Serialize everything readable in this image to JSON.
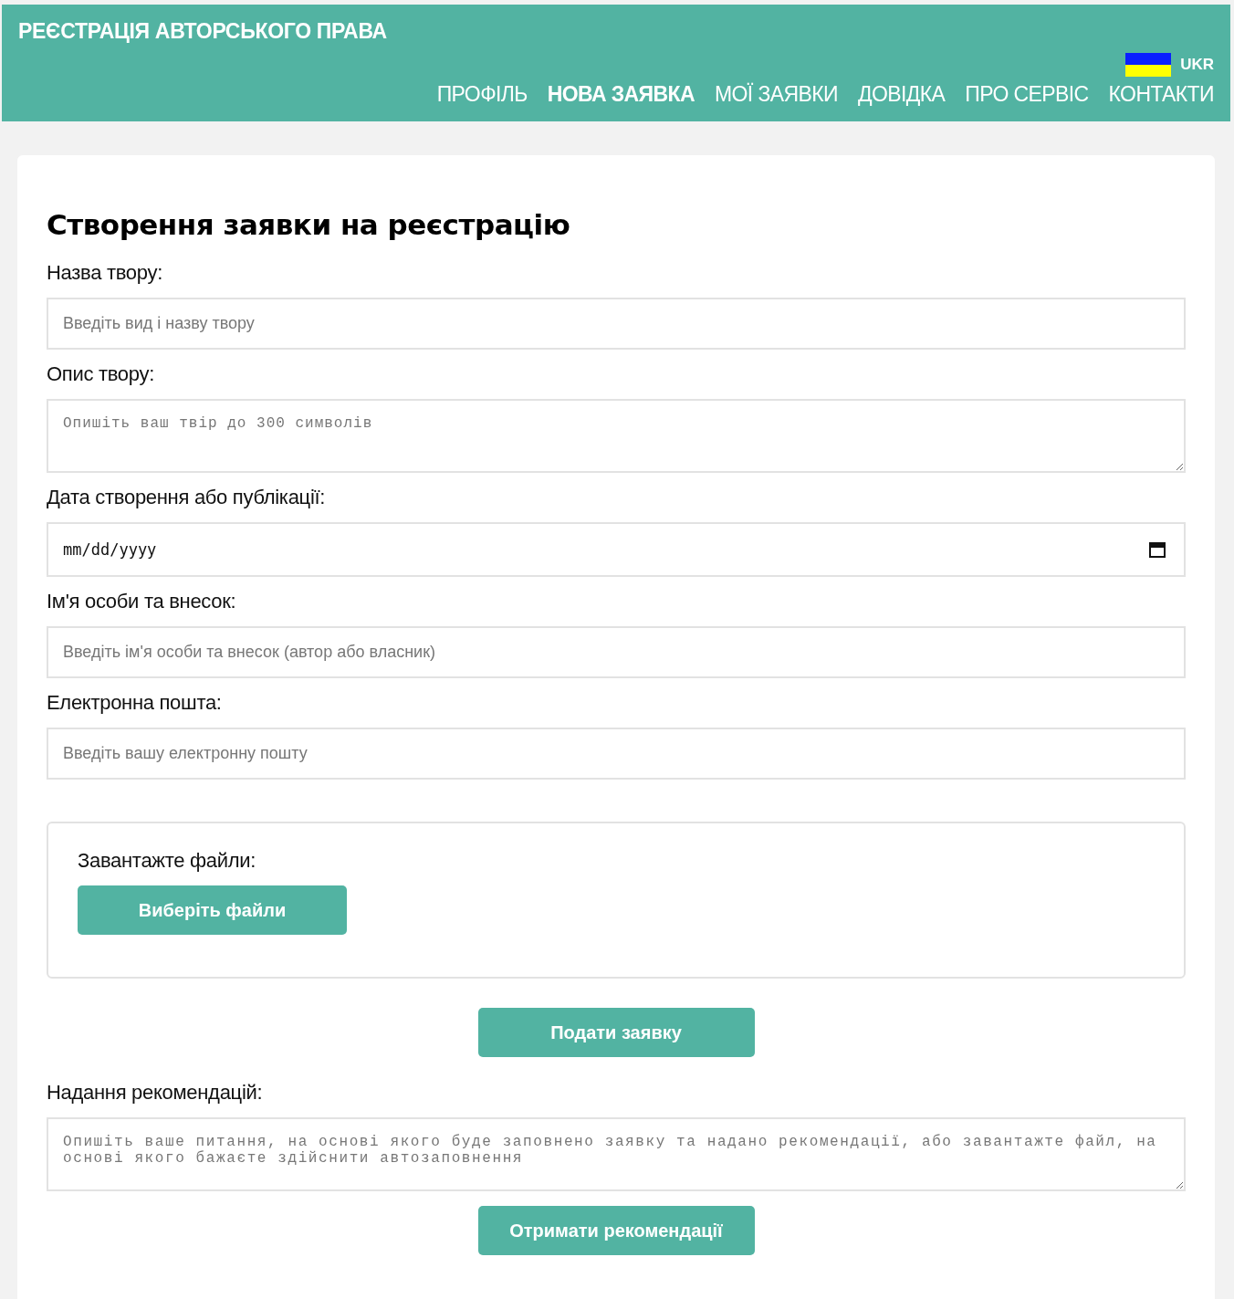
{
  "header": {
    "title": "РЕЄСТРАЦІЯ АВТОРСЬКОГО ПРАВА",
    "language": "UKR",
    "nav": [
      {
        "label": "ПРОФІЛЬ",
        "selected": false
      },
      {
        "label": "НОВА ЗАЯВКА",
        "selected": true
      },
      {
        "label": "МОЇ ЗАЯВКИ",
        "selected": false
      },
      {
        "label": "ДОВІДКА",
        "selected": false
      },
      {
        "label": "ПРО СЕРВІС",
        "selected": false
      },
      {
        "label": "КОНТАКТИ",
        "selected": false
      }
    ]
  },
  "form": {
    "heading": "Створення заявки на реєстрацію",
    "fields": [
      {
        "kind": "text",
        "label": "Назва твору:",
        "placeholder": "Введіть вид і назву твору"
      },
      {
        "kind": "textarea",
        "label": "Опис твору:",
        "placeholder": "Опишіть ваш твір до 300 символів"
      },
      {
        "kind": "date",
        "label": "Дата створення або публікації:",
        "placeholder": "mm/dd/yyyy"
      },
      {
        "kind": "text",
        "label": "Ім'я особи та внесок:",
        "placeholder": "Введіть ім'я особи та внесок (автор або власник)"
      },
      {
        "kind": "text",
        "label": "Електронна пошта:",
        "placeholder": "Введіть вашу електронну пошту"
      }
    ],
    "upload": {
      "label": "Завантажте файли:",
      "button": "Виберіть файли"
    },
    "submit": "Подати заявку",
    "recommendations": {
      "label": "Надання рекомендацій:",
      "placeholder": "Опишіть ваше питання, на основі якого буде заповнено заявку та надано рекомендації, або завантажте файл, на основі якого бажаєте здійснити автозаповнення",
      "button": "Отримати рекомендації"
    }
  }
}
